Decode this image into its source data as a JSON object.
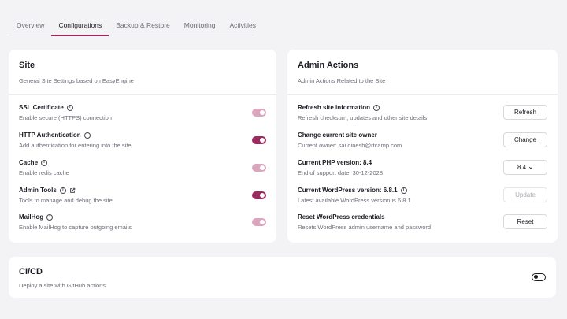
{
  "tabs": [
    "Overview",
    "Configurations",
    "Backup & Restore",
    "Monitoring",
    "Activities"
  ],
  "active_tab": "Configurations",
  "site": {
    "title": "Site",
    "subtitle": "General Site Settings based on EasyEngine",
    "settings": [
      {
        "title": "SSL Certificate",
        "desc": "Enable secure (HTTPS) connection",
        "enabled": true
      },
      {
        "title": "HTTP Authentication",
        "desc": "Add authentication for entering into the site",
        "enabled": true
      },
      {
        "title": "Cache",
        "desc": "Enable redis cache",
        "enabled": true
      },
      {
        "title": "Admin Tools",
        "desc": "Tools to manage and debug the site",
        "enabled": true
      },
      {
        "title": "MailHog",
        "desc": "Enable MailHog to capture outgoing emails",
        "enabled": true
      }
    ]
  },
  "admin": {
    "title": "Admin Actions",
    "subtitle": "Admin Actions Related to the Site",
    "actions": [
      {
        "title": "Refresh site information",
        "desc": "Refresh checksum, updates and other site details",
        "button": "Refresh"
      },
      {
        "title": "Change current site owner",
        "desc": "Current owner: sai.dinesh@rtcamp.com",
        "button": "Change"
      },
      {
        "title": "Current PHP version: 8.4",
        "desc": "End of support date: 30-12-2028",
        "button": "8.4"
      },
      {
        "title": "Current WordPress version: 6.8.1",
        "desc": "Latest available WordPress version is 6.8.1",
        "button": "Update"
      },
      {
        "title": "Reset WordPress credentials",
        "desc": "Resets WordPress admin username and password",
        "button": "Reset"
      }
    ]
  },
  "cicd": {
    "title": "CI/CD",
    "subtitle": "Deploy a site with GitHub actions",
    "enabled": false
  },
  "colors": {
    "accent": "#9b2a5f",
    "accent_light": "#dca5be",
    "background": "#f3f2f4"
  },
  "icons": [
    "info-icon",
    "external-link-icon",
    "chevron-down-icon"
  ]
}
